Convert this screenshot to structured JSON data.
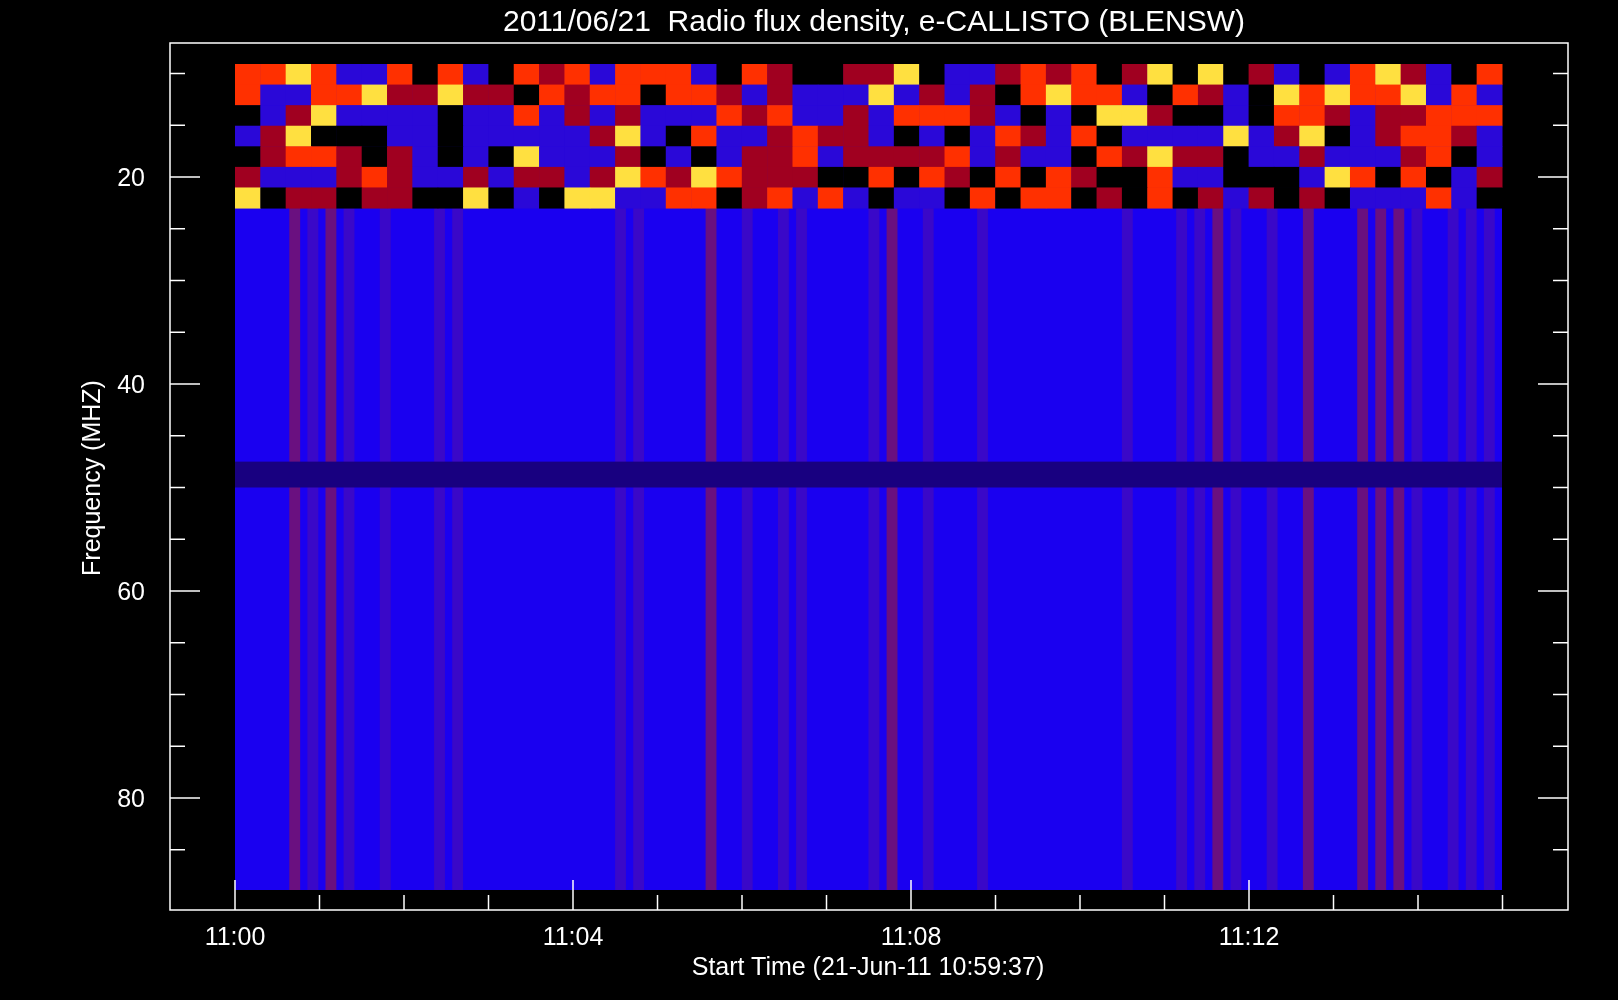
{
  "plot": {
    "title": "2011/06/21  Radio flux density, e-CALLISTO (BLENSW)",
    "ylabel": "Frequency (MHZ)",
    "xlabel": "Start Time (21-Jun-11 10:59:37)",
    "yticks": [
      "20",
      "40",
      "60",
      "80"
    ],
    "xticks": [
      "11:00",
      "11:04",
      "11:08",
      "11:12"
    ]
  }
}
